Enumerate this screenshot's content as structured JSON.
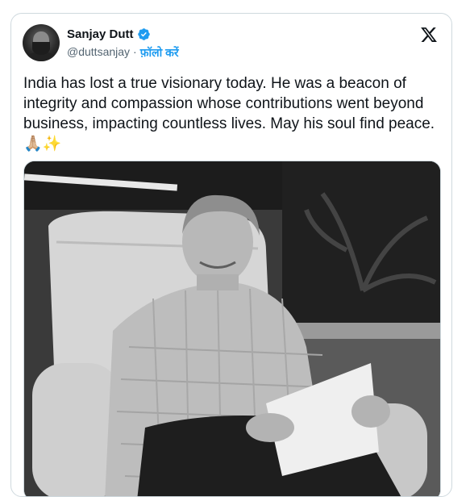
{
  "author": {
    "name": "Sanjay Dutt",
    "handle": "@duttsanjay",
    "separator": "·",
    "follow_label": "फ़ॉलो करें",
    "verified": true
  },
  "tweet": {
    "text": "India has lost a true visionary today. He was a beacon of integrity and compassion whose contributions went beyond business, impacting countless lives. May his soul find peace. 🙏🏼✨"
  },
  "icons": {
    "logo": "x-logo-icon",
    "verified": "verified-badge-icon"
  },
  "colors": {
    "accent": "#1d9bf0",
    "text": "#0f1419",
    "muted": "#536471",
    "border": "#cfd9de"
  }
}
